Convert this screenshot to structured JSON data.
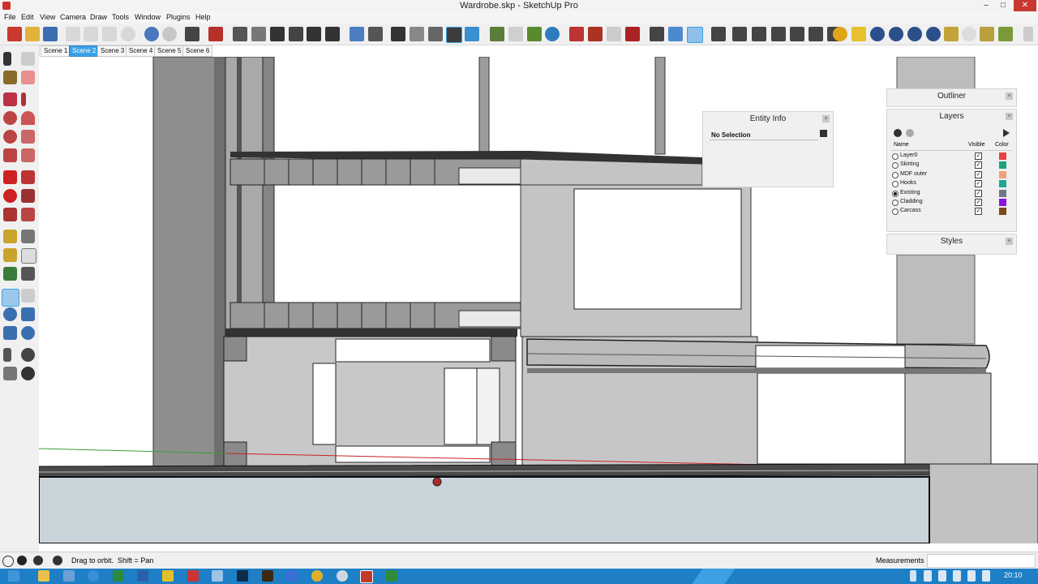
{
  "window": {
    "title": "Wardrobe.skp - SketchUp Pro",
    "min": "–",
    "max": "□",
    "close": "✕"
  },
  "menu": [
    "File",
    "Edit",
    "View",
    "Camera",
    "Draw",
    "Tools",
    "Window",
    "Plugins",
    "Help"
  ],
  "scenes": {
    "tabs": [
      "Scene 1",
      "Scene 2",
      "Scene 3",
      "Scene 4",
      "Scene 5",
      "Scene 6"
    ],
    "active_index": 1
  },
  "entity_info": {
    "title": "Entity Info",
    "selection": "No Selection",
    "close": "×"
  },
  "outliner": {
    "title": "Outliner",
    "close": "×"
  },
  "layers": {
    "title": "Layers",
    "close": "×",
    "columns": {
      "name": "Name",
      "visible": "Visible",
      "color": "Color"
    },
    "rows": [
      {
        "name": "Layer0",
        "active": false,
        "visible": true,
        "color": "#e8413f"
      },
      {
        "name": "Skirting",
        "active": false,
        "visible": true,
        "color": "#1aa37a"
      },
      {
        "name": "MDF outer",
        "active": false,
        "visible": true,
        "color": "#f2a07c"
      },
      {
        "name": "Hooks",
        "active": false,
        "visible": true,
        "color": "#1fa594"
      },
      {
        "name": "Existing",
        "active": true,
        "visible": true,
        "color": "#6e7a86"
      },
      {
        "name": "Cladding",
        "active": false,
        "visible": true,
        "color": "#8d11e3"
      },
      {
        "name": "Carcass",
        "active": false,
        "visible": true,
        "color": "#7a4a18"
      }
    ]
  },
  "styles": {
    "title": "Styles",
    "close": "×"
  },
  "status": {
    "hint": "Drag to orbit.  Shift = Pan",
    "measurements_label": "Measurements",
    "measurements_value": ""
  },
  "taskbar": {
    "clock": "20:10"
  },
  "colors": {
    "accent": "#3aa1e6",
    "taskbar": "#1e7fc7",
    "close": "#c7392f"
  }
}
